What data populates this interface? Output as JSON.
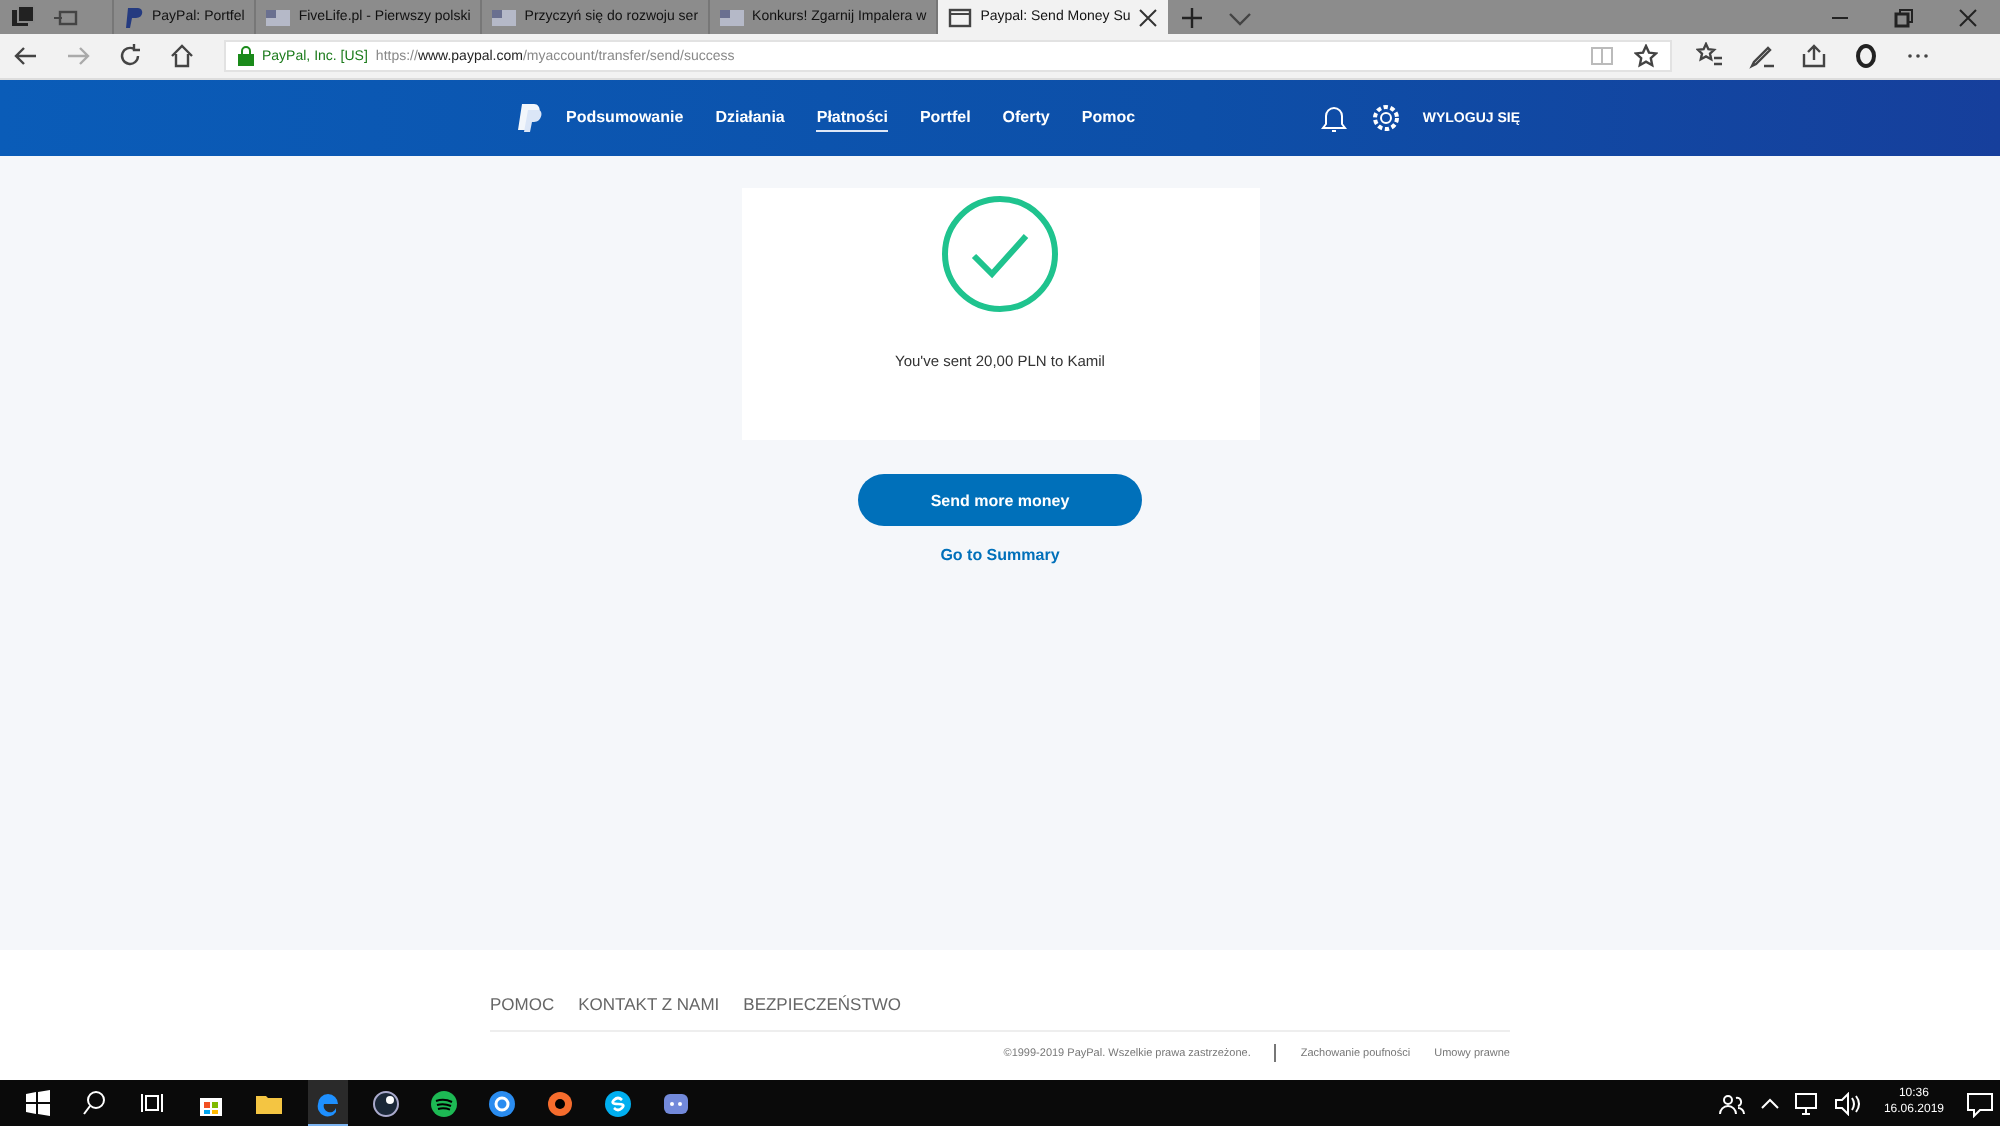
{
  "browser": {
    "tabs": [
      {
        "title": "PayPal: Portfel",
        "selected": false
      },
      {
        "title": "FiveLife.pl - Pierwszy polski",
        "selected": false
      },
      {
        "title": "Przyczyń się do rozwoju ser",
        "selected": false
      },
      {
        "title": "Konkurs! Zgarnij Impalera w",
        "selected": false
      },
      {
        "title": "Paypal: Send Money Su",
        "selected": true
      }
    ],
    "site_identity": "PayPal, Inc. [US]",
    "url_prefix": "https://",
    "url_domain": "www.paypal.com",
    "url_path": "/myaccount/transfer/send/success"
  },
  "nav": {
    "items": [
      {
        "label": "Podsumowanie",
        "selected": false
      },
      {
        "label": "Działania",
        "selected": false
      },
      {
        "label": "Płatności",
        "selected": true
      },
      {
        "label": "Portfel",
        "selected": false
      },
      {
        "label": "Oferty",
        "selected": false
      },
      {
        "label": "Pomoc",
        "selected": false
      }
    ],
    "logout": "WYLOGUJ SIĘ"
  },
  "confirmation": {
    "message": "You've sent 20,00 PLN to Kamil"
  },
  "primary_button": "Send more money",
  "summary_link": "Go to Summary",
  "footer": {
    "links": [
      "POMOC",
      "KONTAKT Z NAMI",
      "BEZPIECZEŃSTWO"
    ],
    "copyright": "©1999-2019 PayPal. Wszelkie prawa zastrzeżone.",
    "legal_links": [
      "Zachowanie poufności",
      "Umowy prawne"
    ]
  },
  "taskbar": {
    "time": "10:36",
    "date": "16.06.2019"
  }
}
